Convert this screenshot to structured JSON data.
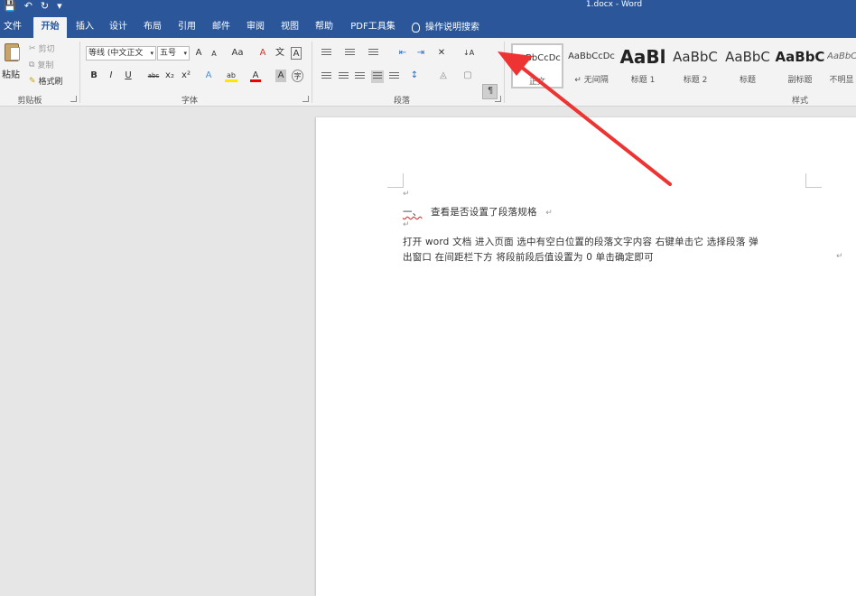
{
  "titlebar": {
    "title": "1.docx  -  Word",
    "quick_access": [
      "💾",
      "↶",
      "↻",
      "▾"
    ]
  },
  "menu": {
    "tabs": [
      "文件",
      "开始",
      "插入",
      "设计",
      "布局",
      "引用",
      "邮件",
      "审阅",
      "视图",
      "帮助",
      "PDF工具集"
    ],
    "active": "开始",
    "tell_me": "操作说明搜索"
  },
  "ribbon": {
    "clipboard": {
      "paste": "粘贴",
      "cut": "剪切",
      "copy": "复制",
      "format_painter": "格式刷",
      "label": "剪贴板"
    },
    "font": {
      "font_name": "等线 (中文正文",
      "font_size": "五号",
      "grow": "A",
      "shrink": "A",
      "change_case": "Aa",
      "clear": "A",
      "phonetic": "文",
      "border_char": "A",
      "bold": "B",
      "italic": "I",
      "underline": "U",
      "strike": "abc",
      "subscript": "x₂",
      "superscript": "x²",
      "text_effect": "A",
      "highlight": "ab",
      "font_color": "A",
      "shading": "A",
      "enclose": "字",
      "label": "字体"
    },
    "paragraph": {
      "label": "段落"
    },
    "styles": {
      "label": "样式",
      "items": [
        {
          "sample": "AaBbCcDc",
          "name": "正文"
        },
        {
          "sample": "AaBbCcDc",
          "name": "↵ 无间隔"
        },
        {
          "sample": "AaBl",
          "name": "标题 1"
        },
        {
          "sample": "AaBbC",
          "name": "标题 2"
        },
        {
          "sample": "AaBbC",
          "name": "标题"
        },
        {
          "sample": "AaBbC",
          "name": "副标题"
        },
        {
          "sample": "AaBbC",
          "name": "不明显"
        }
      ]
    }
  },
  "document": {
    "para_mark": "↵",
    "heading_num": "一、",
    "heading": "查看是否设置了段落规格",
    "body_line1": "打开 word 文档   进入页面   选中有空白位置的段落文字内容   右键单击它   选择段落   弹",
    "body_line2": "出窗口   在间距栏下方   将段前段后值设置为 0   单击确定即可"
  },
  "colors": {
    "titlebar": "#2b579a",
    "ribbon": "#f3f3f3",
    "arrow": "#ee3333"
  }
}
